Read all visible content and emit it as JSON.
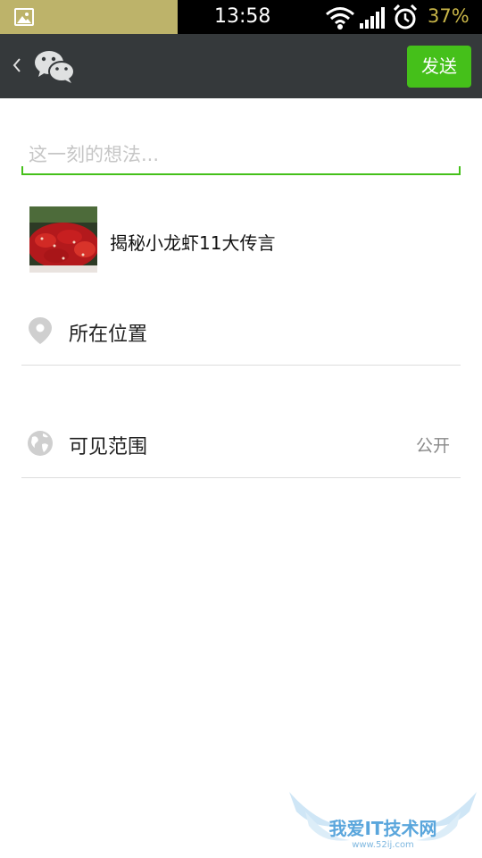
{
  "status_bar": {
    "time": "13:58",
    "battery": "37%",
    "colors": {
      "left_bg": "#bdb36a",
      "battery_text": "#c8b548"
    }
  },
  "header": {
    "send_label": "发送",
    "accent": "#45c01a"
  },
  "compose": {
    "placeholder": "这一刻的想法..."
  },
  "shared_link": {
    "title": "揭秘小龙虾11大传言"
  },
  "options": {
    "location_label": "所在位置",
    "visibility_label": "可见范围",
    "visibility_value": "公开"
  },
  "icons": {
    "back": "back-chevron-icon",
    "wechat": "wechat-logo-icon",
    "location": "location-pin-icon",
    "visibility": "globe-icon"
  },
  "watermark": {
    "text": "我爱IT技术网",
    "url": "www.52ij.com"
  }
}
